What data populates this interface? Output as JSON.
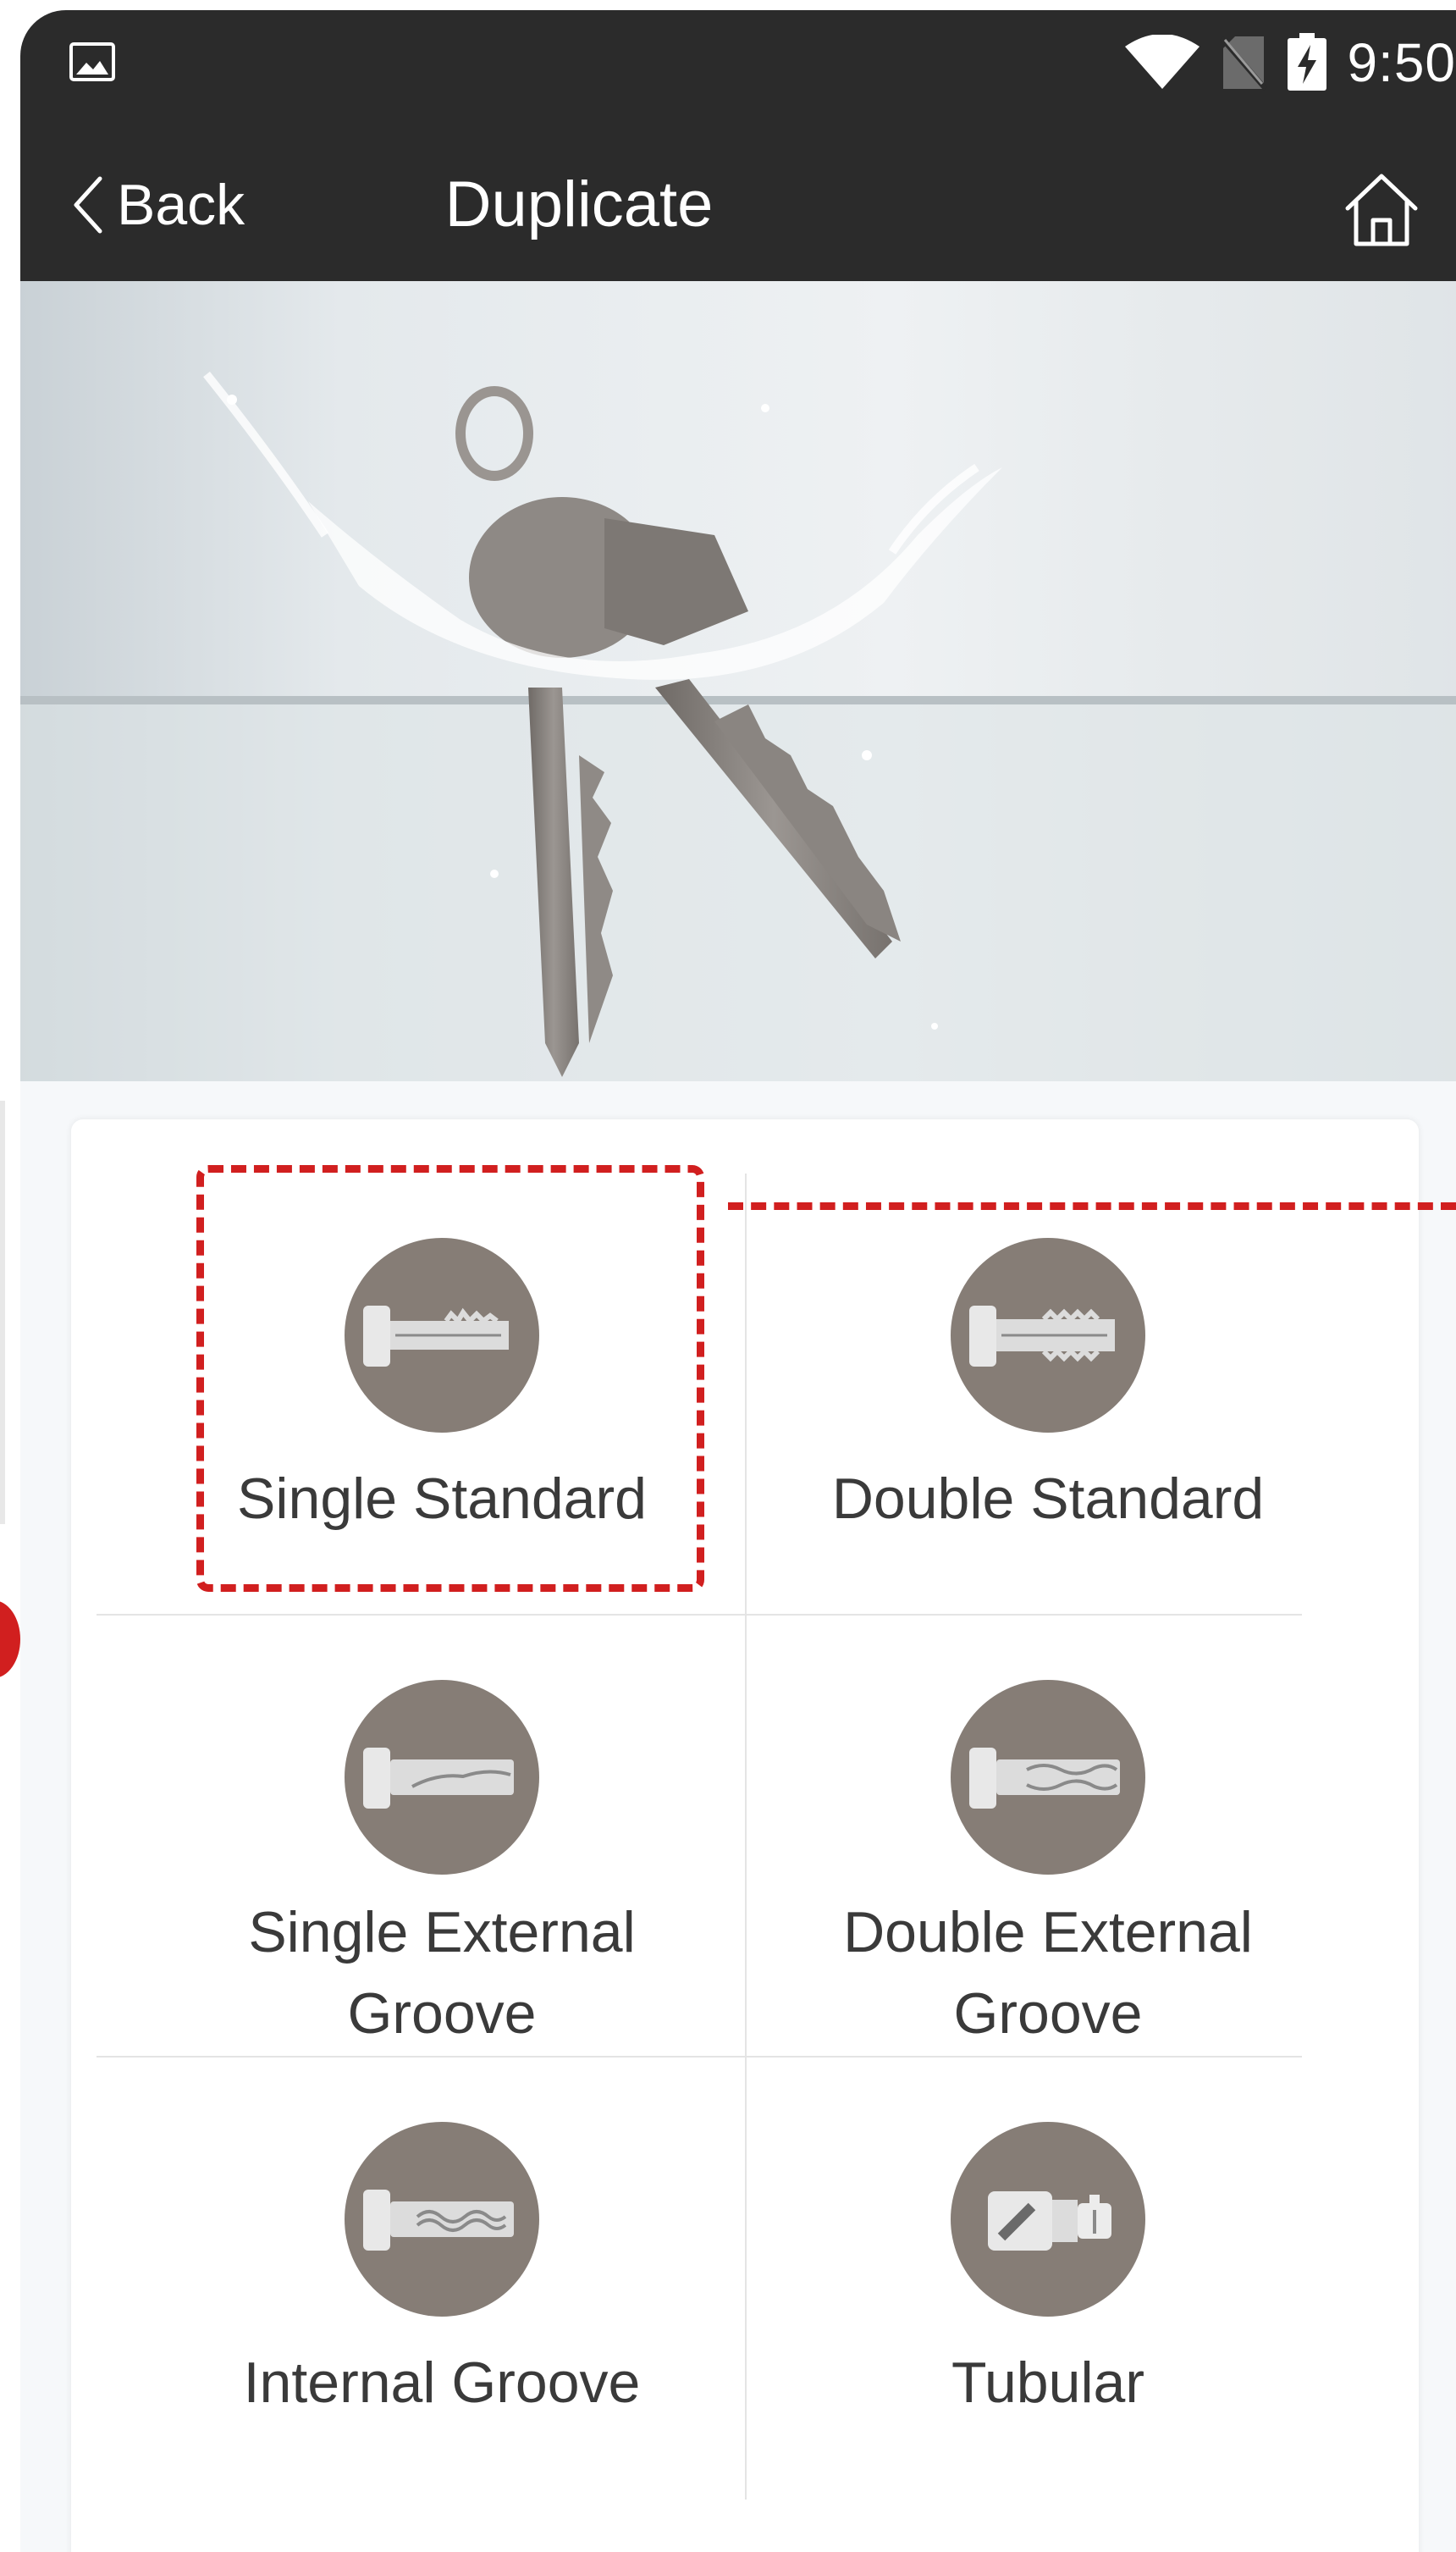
{
  "status_bar": {
    "time": "9:50",
    "icons": [
      "image-notification-icon",
      "wifi-icon",
      "no-sim-icon",
      "battery-charging-icon"
    ]
  },
  "app_bar": {
    "back_label": "Back",
    "title": "Duplicate",
    "home_icon": "home-icon"
  },
  "hero": {
    "image": "keys-splashing-in-water"
  },
  "key_types": [
    {
      "label": "Single Standard",
      "icon": "single-standard-key-icon",
      "selected": true
    },
    {
      "label": "Double Standard",
      "icon": "double-standard-key-icon",
      "selected": false
    },
    {
      "label": "Single External\nGroove",
      "icon": "single-external-groove-key-icon",
      "selected": false
    },
    {
      "label": "Double External\nGroove",
      "icon": "double-external-groove-key-icon",
      "selected": false
    },
    {
      "label": "Internal Groove",
      "icon": "internal-groove-key-icon",
      "selected": false
    },
    {
      "label": "Tubular",
      "icon": "tubular-key-icon",
      "selected": false
    }
  ],
  "colors": {
    "bar_background": "#2b2b2b",
    "icon_circle": "#867d76",
    "highlight": "#d11f1f"
  }
}
